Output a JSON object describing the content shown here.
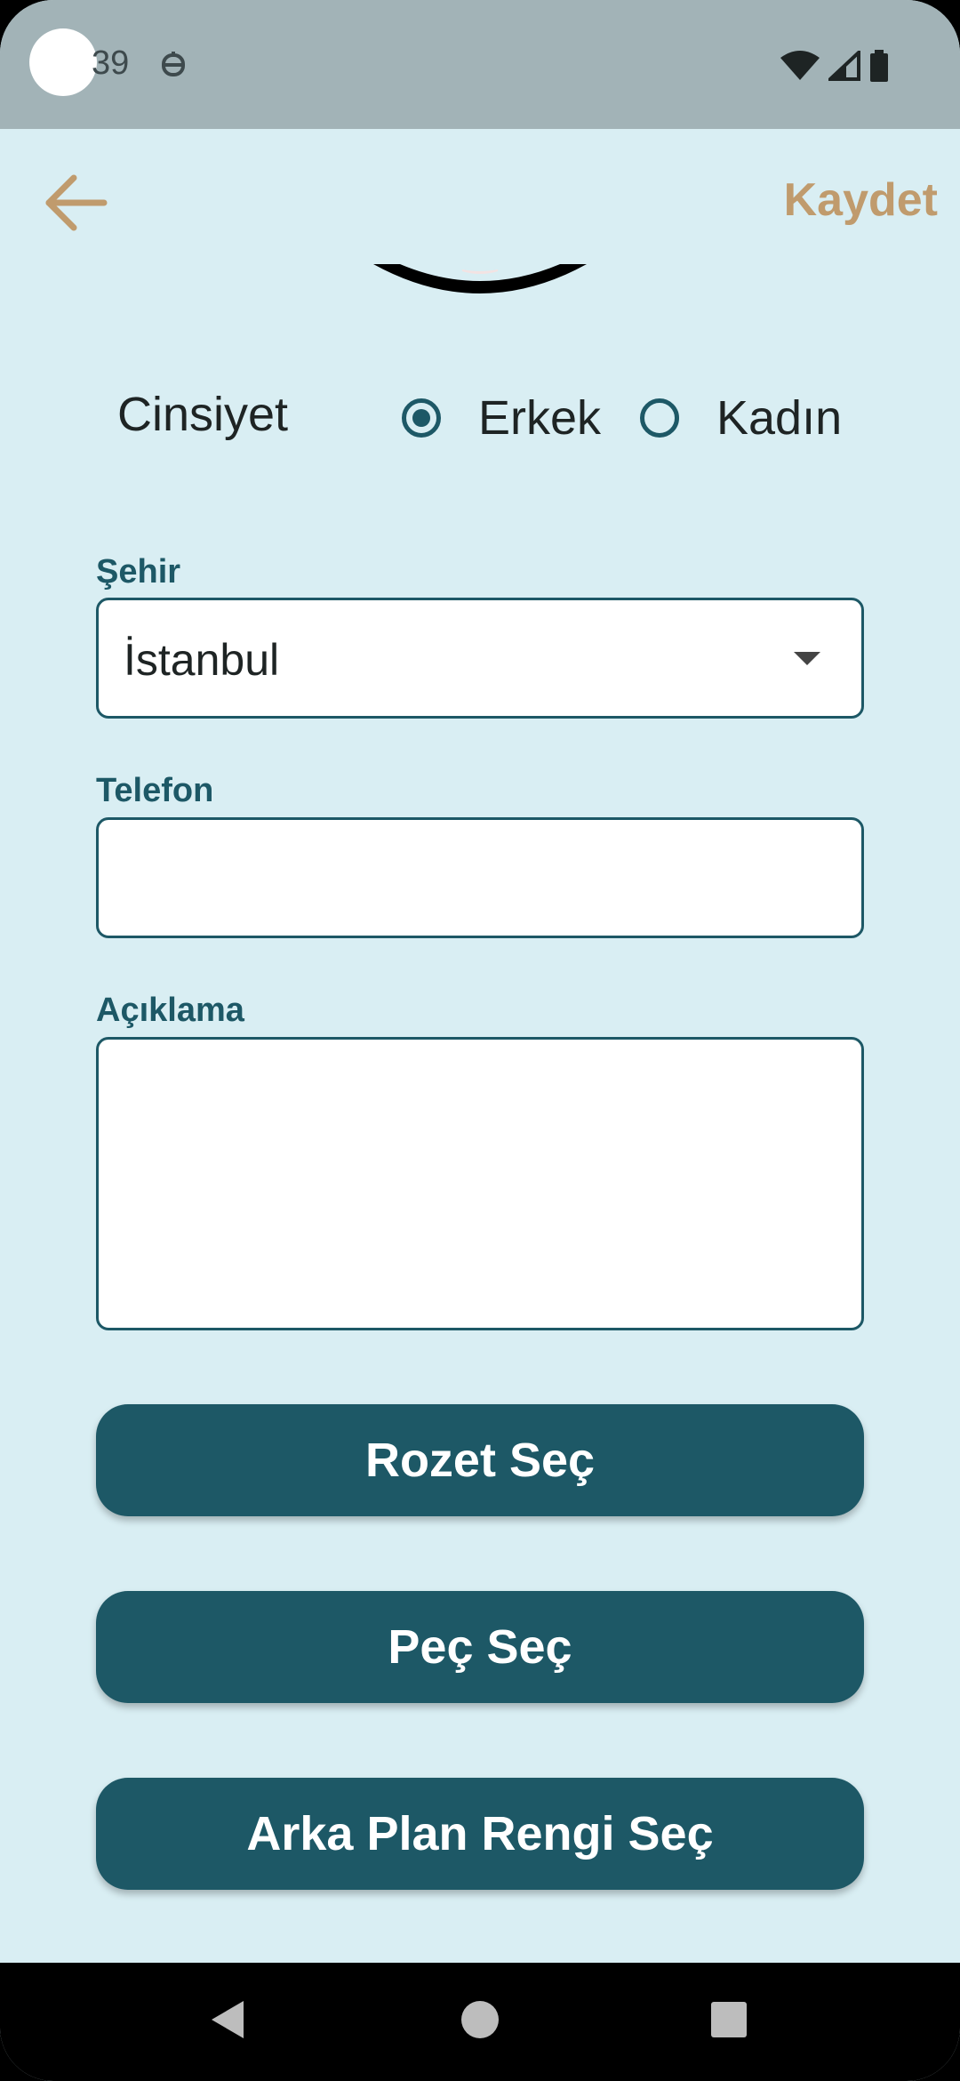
{
  "status_bar": {
    "time": "39",
    "icons": [
      "notification-icon",
      "wifi-icon",
      "signal-icon",
      "battery-icon"
    ]
  },
  "app_bar": {
    "back_icon": "arrow-left-icon",
    "save_label": "Kaydet"
  },
  "gender": {
    "label": "Cinsiyet",
    "options": [
      {
        "label": "Erkek",
        "checked": true
      },
      {
        "label": "Kadın",
        "checked": false
      }
    ]
  },
  "city": {
    "label": "Şehir",
    "value": "İstanbul"
  },
  "phone": {
    "label": "Telefon",
    "value": ""
  },
  "description": {
    "label": "Açıklama",
    "value": ""
  },
  "buttons": {
    "badge": "Rozet Seç",
    "patch": "Peç Seç",
    "background_color": "Arka Plan Rengi Seç"
  },
  "nav_bar": {
    "icons": [
      "nav-back-icon",
      "nav-home-icon",
      "nav-recents-icon"
    ]
  },
  "colors": {
    "background": "#d9eef3",
    "primary": "#1d5866",
    "accent": "#c09b6d",
    "status_bar": "#a2b3b7"
  }
}
